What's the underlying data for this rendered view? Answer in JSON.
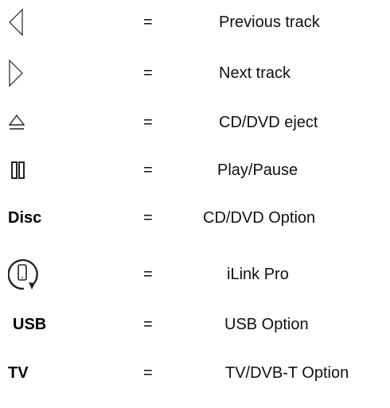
{
  "colors": {
    "text": "#111111",
    "icon_stroke": "#222222"
  },
  "rows": [
    {
      "icon": "previous-track-icon",
      "symbol_text": "",
      "equals": "=",
      "description": "Previous track"
    },
    {
      "icon": "next-track-icon",
      "symbol_text": "",
      "equals": "=",
      "description": "Next track"
    },
    {
      "icon": "eject-icon",
      "symbol_text": "",
      "equals": "=",
      "description": "CD/DVD eject"
    },
    {
      "icon": "play-pause-icon",
      "symbol_text": "",
      "equals": "=",
      "description": "Play/Pause"
    },
    {
      "icon": "",
      "symbol_text": "Disc",
      "equals": "=",
      "description": "CD/DVD Option"
    },
    {
      "icon": "phone-link-icon",
      "symbol_text": "",
      "equals": "=",
      "description": "iLink Pro"
    },
    {
      "icon": "",
      "symbol_text": "USB",
      "equals": "=",
      "description": "USB Option"
    },
    {
      "icon": "",
      "symbol_text": "TV",
      "equals": "=",
      "description": "TV/DVB-T Option"
    }
  ]
}
